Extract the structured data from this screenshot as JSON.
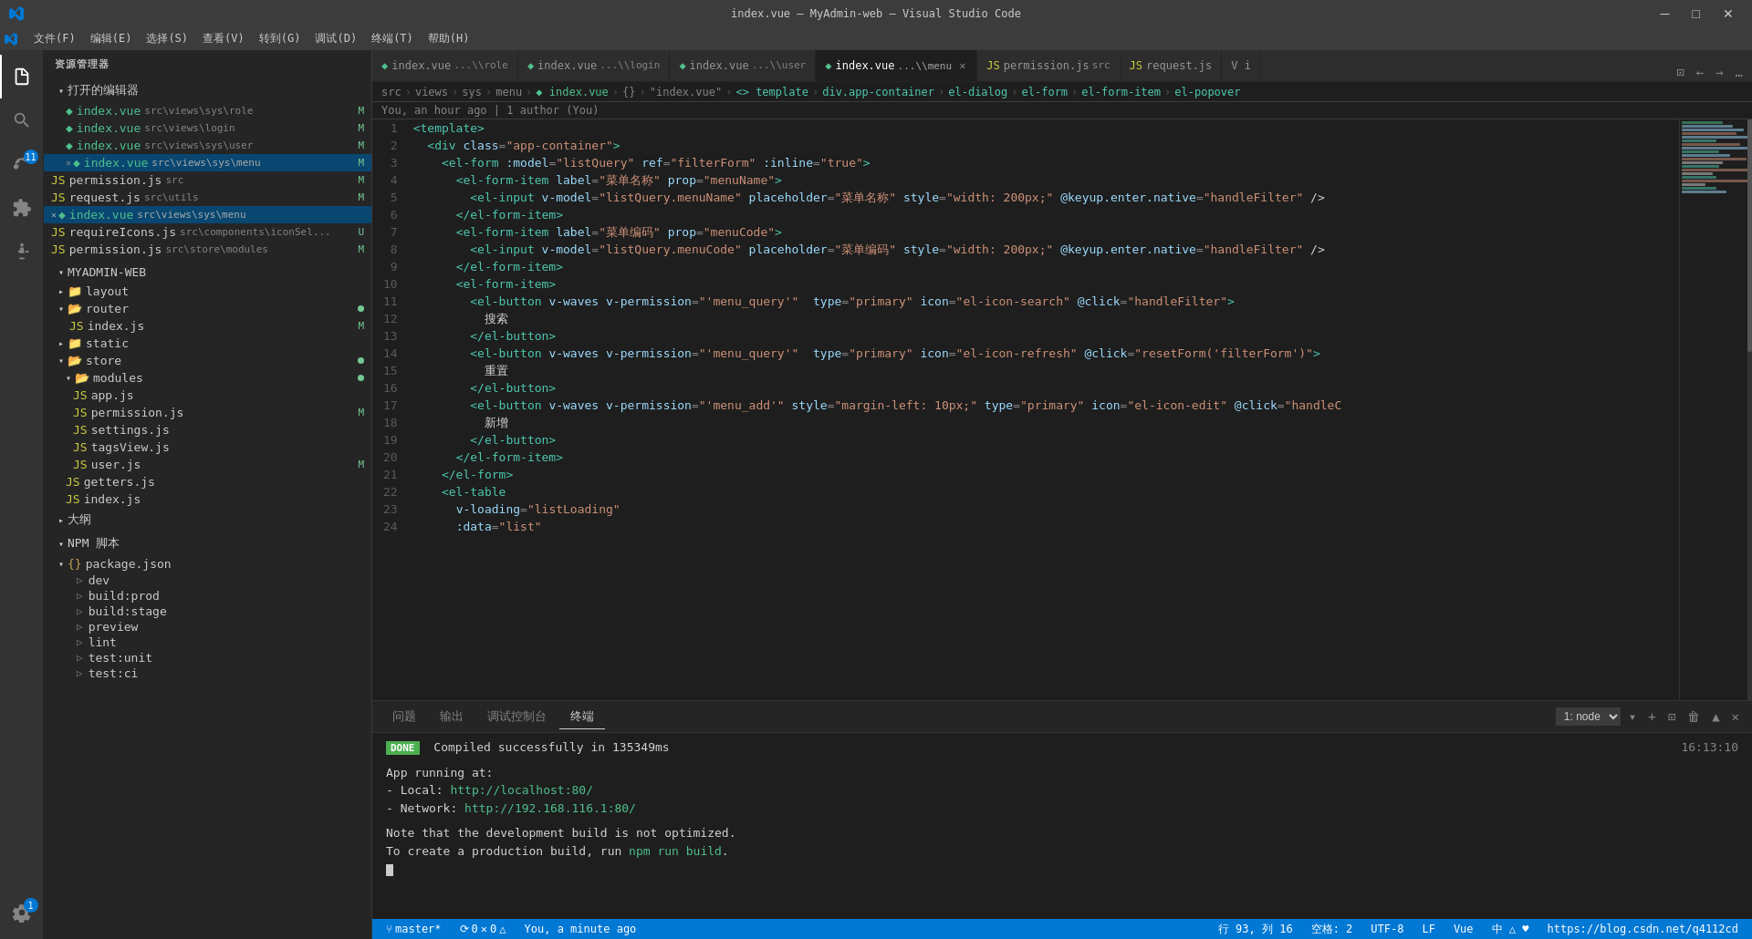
{
  "titleBar": {
    "title": "index.vue — MyAdmin-web — Visual Studio Code",
    "menus": [
      "文件(F)",
      "编辑(E)",
      "选择(S)",
      "查看(V)",
      "转到(G)",
      "调试(D)",
      "终端(T)",
      "帮助(H)"
    ]
  },
  "activityBar": {
    "icons": [
      {
        "name": "explorer-icon",
        "symbol": "📄",
        "active": true
      },
      {
        "name": "search-icon",
        "symbol": "🔍",
        "active": false
      },
      {
        "name": "source-control-icon",
        "symbol": "⑂",
        "active": false,
        "badge": "11"
      },
      {
        "name": "extensions-icon",
        "symbol": "⬛",
        "active": false
      },
      {
        "name": "run-icon",
        "symbol": "▶",
        "active": false
      }
    ]
  },
  "sidebar": {
    "title": "资源管理器",
    "openEditors": {
      "label": "打开的编辑器",
      "items": [
        {
          "name": "index.vue",
          "path": "src\\views\\sys\\role",
          "icon": "vue",
          "badge": "M"
        },
        {
          "name": "index.vue",
          "path": "src\\views\\login",
          "icon": "vue",
          "badge": "M"
        },
        {
          "name": "index.vue",
          "path": "src\\views\\sys\\user",
          "icon": "vue",
          "badge": "M"
        },
        {
          "name": "index.vue",
          "path": "src\\views\\sys\\menu",
          "icon": "vue",
          "badge": "M",
          "active": true,
          "hasClose": true
        }
      ]
    },
    "myadminWeb": {
      "label": "MYADMIN-WEB",
      "items": [
        {
          "name": "layout",
          "type": "folder",
          "indent": 12
        },
        {
          "name": "router",
          "type": "folder",
          "indent": 12,
          "badge": "dot"
        },
        {
          "name": "index.js",
          "type": "js",
          "indent": 20,
          "badge": "M"
        },
        {
          "name": "static",
          "type": "folder",
          "indent": 12
        },
        {
          "name": "store",
          "type": "folder",
          "indent": 12,
          "badge": "dot"
        },
        {
          "name": "modules",
          "type": "folder",
          "indent": 20,
          "badge": "dot"
        },
        {
          "name": "app.js",
          "type": "js",
          "indent": 28
        },
        {
          "name": "permission.js",
          "type": "js",
          "indent": 28,
          "badge": "M"
        },
        {
          "name": "settings.js",
          "type": "js",
          "indent": 28
        },
        {
          "name": "tagsView.js",
          "type": "js",
          "indent": 28
        },
        {
          "name": "user.js",
          "type": "js",
          "indent": 28,
          "badge": "M"
        },
        {
          "name": "getters.js",
          "type": "js",
          "indent": 20
        },
        {
          "name": "index.js",
          "type": "js",
          "indent": 20
        }
      ]
    },
    "extraFiles": [
      {
        "name": "permission.js",
        "path": "src",
        "type": "js",
        "indent": 8,
        "badge": "M"
      },
      {
        "name": "request.js",
        "path": "src\\utils",
        "type": "js",
        "indent": 8,
        "badge": "M"
      },
      {
        "name": "index.vue",
        "path": "src\\views\\sys\\menu",
        "type": "vue",
        "indent": 8,
        "active": true,
        "hasClose": true
      },
      {
        "name": "requireIcons.js",
        "path": "src\\components\\iconSel...",
        "type": "js",
        "indent": 8,
        "badge": "U"
      },
      {
        "name": "permission.js",
        "path": "src\\store\\modules",
        "type": "js",
        "indent": 8,
        "badge": "M"
      }
    ],
    "outline": {
      "label": "大纲"
    },
    "npmScripts": {
      "label": "NPM 脚本",
      "packageJson": "package.json",
      "scripts": [
        "dev",
        "build:prod",
        "build:stage",
        "preview",
        "lint",
        "test:unit",
        "test:ci"
      ]
    }
  },
  "tabs": [
    {
      "label": "index.vue",
      "path": "...\\role",
      "type": "vue",
      "active": false
    },
    {
      "label": "index.vue",
      "path": "...\\login",
      "type": "vue",
      "active": false
    },
    {
      "label": "index.vue",
      "path": "...\\user",
      "type": "vue",
      "active": false
    },
    {
      "label": "index.vue",
      "path": "...\\menu",
      "type": "vue",
      "active": true,
      "hasClose": true
    },
    {
      "label": "permission.js",
      "path": "src",
      "type": "js",
      "active": false
    },
    {
      "label": "request.js",
      "path": "",
      "type": "js",
      "active": false
    },
    {
      "label": "i",
      "path": "",
      "type": "special",
      "active": false
    }
  ],
  "breadcrumb": {
    "items": [
      "src",
      "views",
      "sys",
      "menu",
      "index.vue",
      "{}",
      "\"index.vue\"",
      "template",
      "div.app-container",
      "el-dialog",
      "el-form",
      "el-form-item",
      "el-popover"
    ]
  },
  "gitInfo": "You, an hour ago | 1 author (You)",
  "code": [
    {
      "num": 1,
      "text": "<template>",
      "tokens": [
        {
          "t": "s-tag",
          "v": "<template>"
        }
      ]
    },
    {
      "num": 2,
      "text": "  <div class=\"app-container\">",
      "tokens": [
        {
          "t": "s-punct",
          "v": "  "
        },
        {
          "t": "s-tag",
          "v": "<div"
        },
        {
          "t": "s-text",
          "v": " "
        },
        {
          "t": "s-attr",
          "v": "class"
        },
        {
          "t": "s-punct",
          "v": "="
        },
        {
          "t": "s-val",
          "v": "\"app-container\""
        },
        {
          "t": "s-tag",
          "v": ">"
        }
      ]
    },
    {
      "num": 3,
      "text": "    <el-form :model=\"listQuery\" ref=\"filterForm\" :inline=\"true\">",
      "tokens": [
        {
          "t": "s-text",
          "v": "    "
        },
        {
          "t": "s-tag",
          "v": "<el-form"
        },
        {
          "t": "s-text",
          "v": " "
        },
        {
          "t": "s-attr",
          "v": ":model"
        },
        {
          "t": "s-punct",
          "v": "="
        },
        {
          "t": "s-val",
          "v": "\"listQuery\""
        },
        {
          "t": "s-text",
          "v": " "
        },
        {
          "t": "s-attr",
          "v": "ref"
        },
        {
          "t": "s-punct",
          "v": "="
        },
        {
          "t": "s-val",
          "v": "\"filterForm\""
        },
        {
          "t": "s-text",
          "v": " "
        },
        {
          "t": "s-attr",
          "v": ":inline"
        },
        {
          "t": "s-punct",
          "v": "="
        },
        {
          "t": "s-val",
          "v": "\"true\""
        },
        {
          "t": "s-tag",
          "v": ">"
        }
      ]
    },
    {
      "num": 4,
      "text": "      <el-form-item label=\"菜单名称\" prop=\"menuName\">",
      "tokens": [
        {
          "t": "s-text",
          "v": "      "
        },
        {
          "t": "s-tag",
          "v": "<el-form-item"
        },
        {
          "t": "s-text",
          "v": " "
        },
        {
          "t": "s-attr",
          "v": "label"
        },
        {
          "t": "s-punct",
          "v": "="
        },
        {
          "t": "s-val",
          "v": "\"菜单名称\""
        },
        {
          "t": "s-text",
          "v": " "
        },
        {
          "t": "s-attr",
          "v": "prop"
        },
        {
          "t": "s-punct",
          "v": "="
        },
        {
          "t": "s-val",
          "v": "\"menuName\""
        },
        {
          "t": "s-tag",
          "v": ">"
        }
      ]
    },
    {
      "num": 5,
      "text": "        <el-input v-model=\"listQuery.menuName\" placeholder=\"菜单名称\" style=\"width: 200px;\" @keyup.enter.native=\"handleFilter\" />",
      "tokens": [
        {
          "t": "s-text",
          "v": "        "
        },
        {
          "t": "s-tag",
          "v": "<el-input"
        },
        {
          "t": "s-text",
          "v": " "
        },
        {
          "t": "s-attr",
          "v": "v-model"
        },
        {
          "t": "s-punct",
          "v": "="
        },
        {
          "t": "s-val",
          "v": "\"listQuery.menuName\""
        },
        {
          "t": "s-text",
          "v": " "
        },
        {
          "t": "s-attr",
          "v": "placeholder"
        },
        {
          "t": "s-punct",
          "v": "="
        },
        {
          "t": "s-val",
          "v": "\"菜单名称\""
        },
        {
          "t": "s-text",
          "v": " "
        },
        {
          "t": "s-attr",
          "v": "style"
        },
        {
          "t": "s-punct",
          "v": "="
        },
        {
          "t": "s-val",
          "v": "\"width: 200px;\""
        },
        {
          "t": "s-text",
          "v": " "
        },
        {
          "t": "s-attr",
          "v": "@keyup.enter.native"
        },
        {
          "t": "s-punct",
          "v": "="
        },
        {
          "t": "s-val",
          "v": "\"handleFilter\""
        },
        {
          "t": "s-text",
          "v": " />"
        }
      ]
    },
    {
      "num": 6,
      "text": "      </el-form-item>"
    },
    {
      "num": 7,
      "text": "      <el-form-item label=\"菜单编码\" prop=\"menuCode\">"
    },
    {
      "num": 8,
      "text": "        <el-input v-model=\"listQuery.menuCode\" placeholder=\"菜单编码\" style=\"width: 200px;\" @keyup.enter.native=\"handleFilter\" />"
    },
    {
      "num": 9,
      "text": "      </el-form-item>"
    },
    {
      "num": 10,
      "text": "      <el-form-item>"
    },
    {
      "num": 11,
      "text": "        <el-button v-waves v-permission=\"'menu_query'\"  type=\"primary\" icon=\"el-icon-search\" @click=\"handleFilter\">"
    },
    {
      "num": 12,
      "text": "          搜索"
    },
    {
      "num": 13,
      "text": "        </el-button>"
    },
    {
      "num": 14,
      "text": "        <el-button v-waves v-permission=\"'menu_query'\"  type=\"primary\" icon=\"el-icon-refresh\" @click=\"resetForm('filterForm')\">"
    },
    {
      "num": 15,
      "text": "          重置"
    },
    {
      "num": 16,
      "text": "        </el-button>"
    },
    {
      "num": 17,
      "text": "        <el-button v-waves v-permission=\"'menu_add'\" style=\"margin-left: 10px;\" type=\"primary\" icon=\"el-icon-edit\" @click=\"handleC"
    },
    {
      "num": 18,
      "text": "          新增"
    },
    {
      "num": 19,
      "text": "        </el-button>"
    },
    {
      "num": 20,
      "text": "      </el-form-item>"
    },
    {
      "num": 21,
      "text": "    </el-form>"
    },
    {
      "num": 22,
      "text": "    <el-table"
    },
    {
      "num": 23,
      "text": "      v-loading=\"listLoading\""
    },
    {
      "num": 24,
      "text": "      :data=\"list\""
    }
  ],
  "terminal": {
    "tabs": [
      "问题",
      "输出",
      "调试控制台",
      "终端"
    ],
    "activeTab": "终端",
    "terminalSelect": "1: node",
    "output": [
      {
        "type": "done",
        "text": "Compiled successfully in 135349ms",
        "time": "16:13:10"
      },
      {
        "type": "blank"
      },
      {
        "type": "text",
        "text": "App running at:"
      },
      {
        "type": "text",
        "text": "  - Local:   ",
        "link": "http://localhost:80/"
      },
      {
        "type": "text",
        "text": "  - Network: ",
        "link": "http://192.168.116.1:80/"
      },
      {
        "type": "blank"
      },
      {
        "type": "text",
        "text": "Note that the development build is not optimized."
      },
      {
        "type": "text",
        "text": "To create a production build, run "
      },
      {
        "type": "cursor"
      }
    ]
  },
  "statusBar": {
    "branch": "master*",
    "sync": "⟳",
    "errors": "0",
    "warnings": "0",
    "position": "行 93, 列 16",
    "spaces": "空格: 2",
    "encoding": "UTF-8",
    "lineEnding": "LF",
    "language": "Vue",
    "feedback": "中 △ ♥",
    "link": "https://blog.csdn.net/q4112cd",
    "time": "You, a minute ago"
  }
}
